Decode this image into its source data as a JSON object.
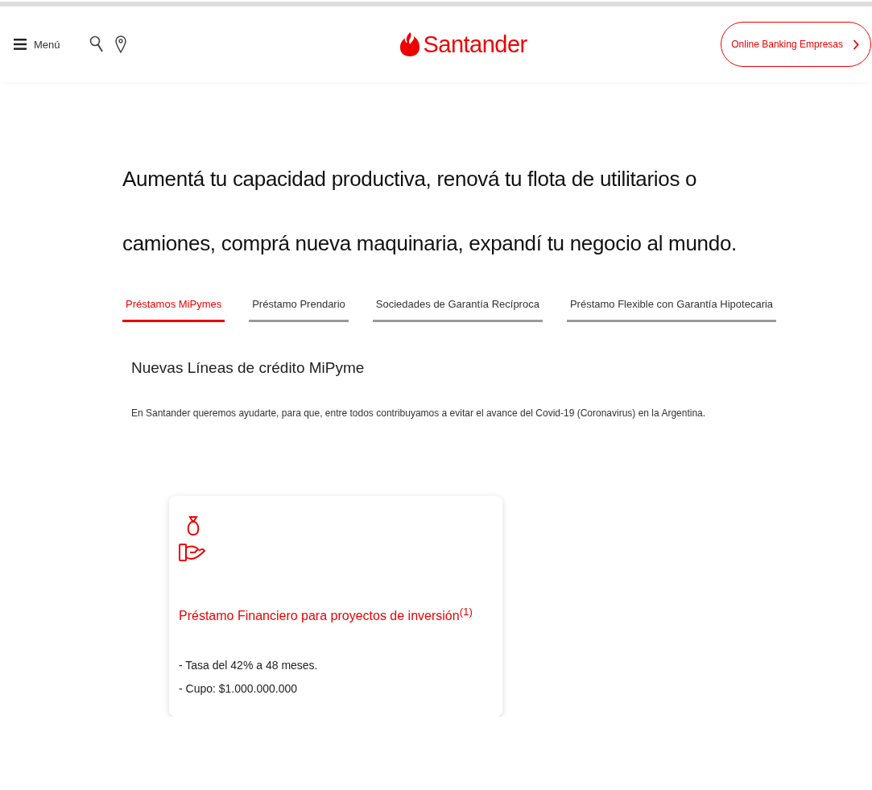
{
  "header": {
    "menu_label": "Menú",
    "logo_text": "Santander",
    "banking_button": "Online Banking Empresas"
  },
  "headline": "Aumentá tu capacidad productiva, renová tu flota de utilitarios o camiones, comprá nueva maquinaria, expandí tu negocio al mundo.",
  "tabs": [
    {
      "label": "Préstamos MiPymes",
      "selected": true
    },
    {
      "label": "Préstamo Prendario",
      "selected": false
    },
    {
      "label": "Sociedades de Garantía Recíproca",
      "selected": false
    },
    {
      "label": "Préstamo Flexible con Garantía Hipotecaria",
      "selected": false
    }
  ],
  "section": {
    "title": "Nuevas Líneas de crédito MiPyme",
    "description": "En Santander queremos ayudarte, para que, entre todos contribuyamos a evitar el avance del Covid-19 (Coronavirus) en la Argentina."
  },
  "cards": [
    {
      "title": "Préstamo Financiero para proyectos de inversión$^{(1)}$",
      "lines": [
        "- Tasa del 42% a 48 meses.",
        "- Cupo: $1.000.000.000"
      ]
    }
  ]
}
